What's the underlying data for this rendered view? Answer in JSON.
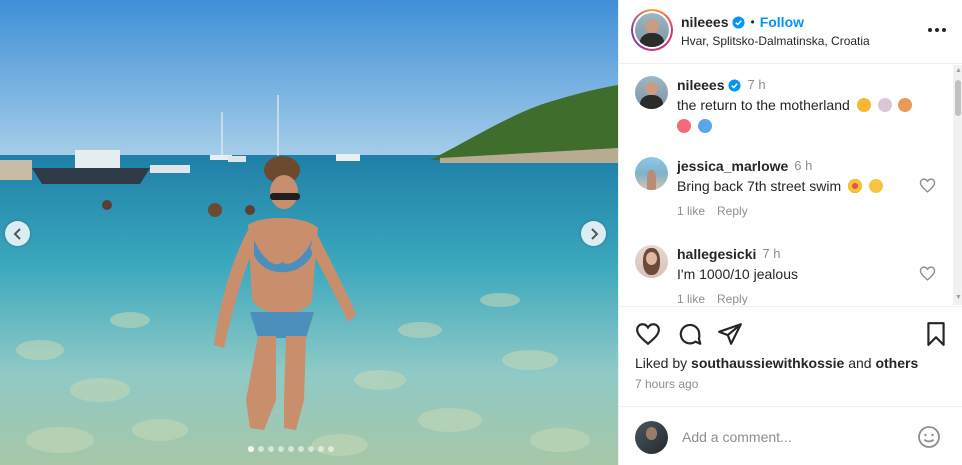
{
  "post": {
    "username": "nileees",
    "follow_label": "Follow",
    "separator": "•",
    "location": "Hvar, Splitsko-Dalmatinska, Croatia",
    "carousel": {
      "total_slides": 9,
      "active_index": 0
    }
  },
  "comments": [
    {
      "username": "nileees",
      "verified": true,
      "time": "7 h",
      "text_line1": "the return to the motherland",
      "text_line2": "",
      "emojis_line1": [
        "sun",
        "shell",
        "flower-bouquet"
      ],
      "emojis_line2": [
        "hibiscus",
        "blue-heart"
      ]
    },
    {
      "username": "jessica_marlowe",
      "time": "6 h",
      "text": "Bring back 7th street swim",
      "emojis": [
        "heart-eyes",
        "clapping"
      ],
      "likes_label": "1 like",
      "reply_label": "Reply"
    },
    {
      "username": "hallegesicki",
      "time": "7 h",
      "text": "I'm 1000/10 jealous",
      "likes_label": "1 like",
      "reply_label": "Reply"
    }
  ],
  "actions": {
    "liked_prefix": "Liked by ",
    "liked_user": "southaussiewithkossie",
    "liked_and": " and ",
    "liked_others": "others",
    "time_ago": "7 hours ago"
  },
  "add_comment": {
    "placeholder": "Add a comment..."
  },
  "colors": {
    "link_blue": "#0095f6",
    "text": "#262626",
    "muted": "#8e8e8e",
    "verified_blue": "#0095f6"
  }
}
